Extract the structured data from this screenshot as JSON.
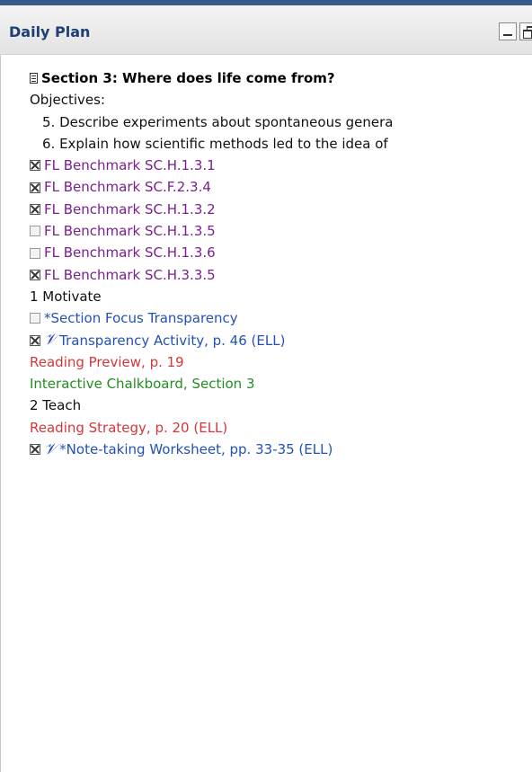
{
  "window": {
    "title": "Daily Plan"
  },
  "section": {
    "title": "Section 3: Where does life come from?",
    "objectives_label": "Objectives:",
    "objectives": [
      "5. Describe experiments about spontaneous genera",
      "6. Explain how scientific methods led to the idea of"
    ]
  },
  "benchmarks": [
    {
      "label": "FL Benchmark SC.H.1.3.1",
      "checked": true
    },
    {
      "label": "FL Benchmark SC.F.2.3.4",
      "checked": true
    },
    {
      "label": "FL Benchmark SC.H.1.3.2",
      "checked": true
    },
    {
      "label": "FL Benchmark SC.H.1.3.5",
      "checked": false
    },
    {
      "label": "FL Benchmark SC.H.1.3.6",
      "checked": false
    },
    {
      "label": "FL Benchmark SC.H.3.3.5",
      "checked": true
    }
  ],
  "motivate": {
    "heading": "1 Motivate",
    "items": [
      {
        "label": "*Section Focus Transparency",
        "checked": false
      },
      {
        "label": "Transparency Activity, p. 46 (ELL)",
        "checked": true,
        "pencil": true
      },
      {
        "label": "Reading Preview, p. 19"
      },
      {
        "label": "Interactive Chalkboard, Section 3"
      }
    ]
  },
  "teach": {
    "heading": "2 Teach",
    "items": [
      {
        "label": "Reading Strategy, p. 20 (ELL)"
      },
      {
        "label": "*Note-taking Worksheet, pp. 33-35 (ELL)",
        "checked": true,
        "pencil": true
      }
    ]
  },
  "colors": {
    "title": "#1d3f73",
    "benchmark": "#7a1f8e",
    "resource_blue": "#2351b8",
    "resource_red": "#d4363a",
    "resource_green": "#238d23"
  },
  "icons": {
    "pencil": "𝒱"
  }
}
